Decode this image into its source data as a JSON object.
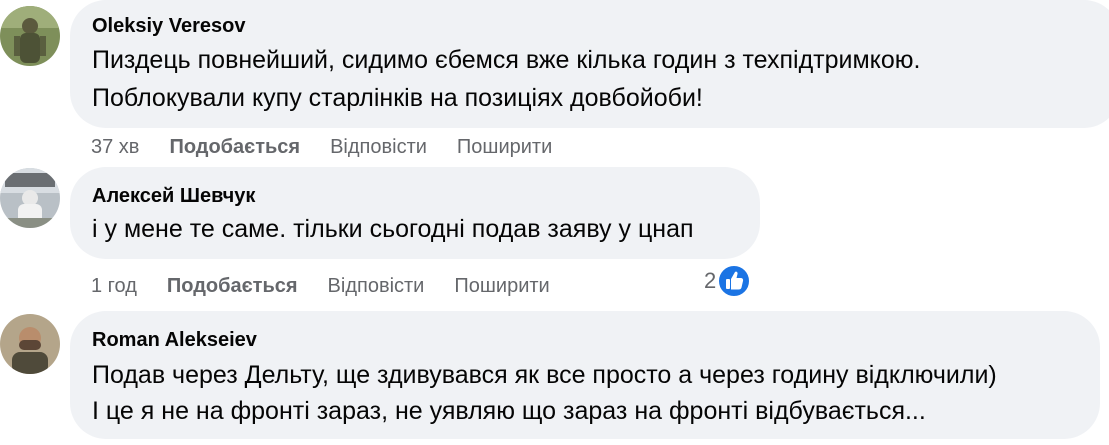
{
  "comments": [
    {
      "author": "Oleksiy Veresov",
      "lines": [
        "Пиздець повнейший, сидимо єбемся вже кілька годин з техпідтримкою.",
        "Поблокували купу старлінків на позиціях довбойоби!"
      ],
      "time": "37 хв",
      "like_label": "Подобається",
      "reply_label": "Відповісти",
      "share_label": "Поширити"
    },
    {
      "author": "Алексей Шевчук",
      "lines": [
        "і у мене те саме. тільки сьогодні подав заяву у цнап"
      ],
      "time": "1 год",
      "like_label": "Подобається",
      "reply_label": "Відповісти",
      "share_label": "Поширити",
      "reaction_count": "2",
      "reaction_icon": "thumbs-up-icon",
      "reaction_color": "#1b74e4"
    },
    {
      "author": "Roman Alekseiev",
      "lines": [
        "Подав через Дельту, ще здивувався як все просто а через годину відключили)",
        "І це я не на фронті зараз, не уявляю що зараз на фронті відбувається..."
      ]
    }
  ],
  "colors": {
    "bubble": "#f0f2f5",
    "secondary_text": "#65676b",
    "accent": "#1b74e4"
  }
}
